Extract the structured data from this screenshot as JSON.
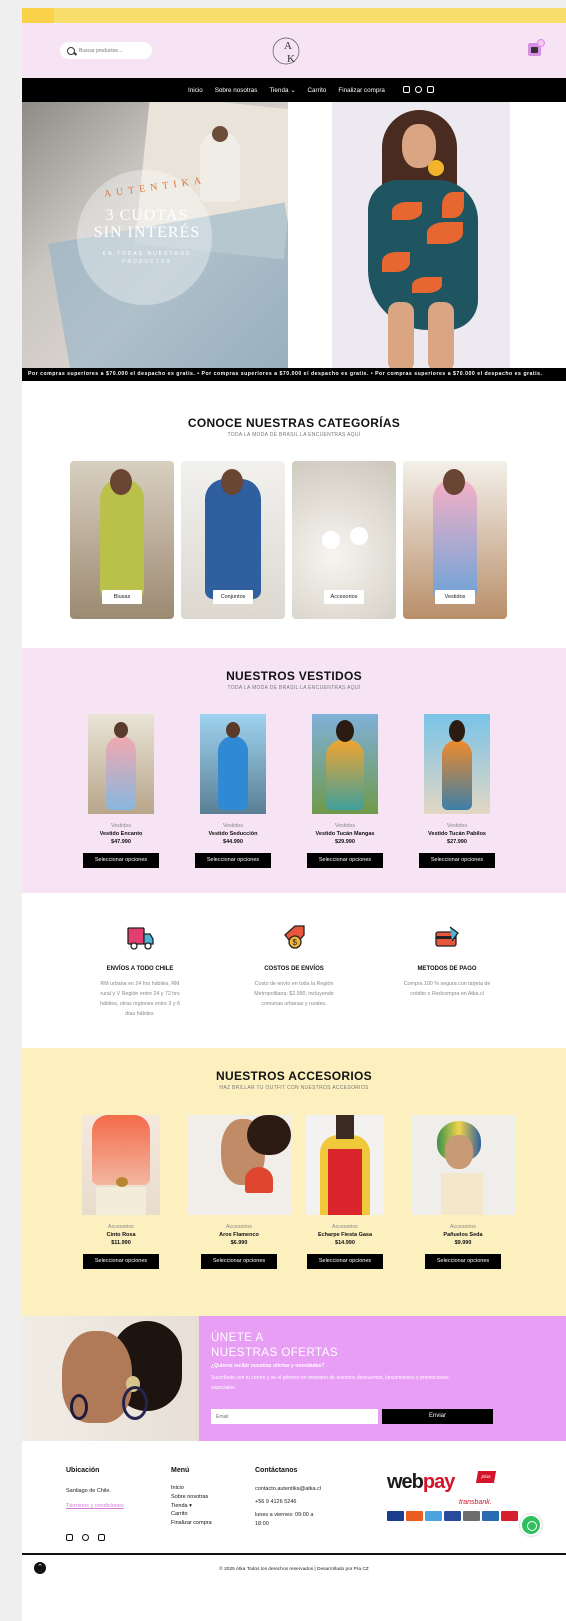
{
  "header": {
    "search_placeholder": "Buscar productos…",
    "logo_text": "AK"
  },
  "nav": {
    "items": [
      "Inicio",
      "Sobre nosotras",
      "Tienda ⌄",
      "Carrito",
      "Finalizar compra"
    ]
  },
  "hero": {
    "brand": "AUTENTIKA",
    "headline_1": "3 CUOTAS",
    "headline_2": "SIN INTERÉS",
    "small_1": "EN TODAS NUESTROS",
    "small_2": "PRODUCTOS"
  },
  "marquee": "Por compras superiores a $70.000 el despacho es gratis. • Por compras superiores a $70.000 el despacho es gratis. • Por compras superiores a $70.000 el despacho es gratis.",
  "categories": {
    "title": "CONOCE NUESTRAS CATEGORÍAS",
    "subtitle": "TODA LA MODA DE BRASIL LA ENCUENTRAS AQUÍ",
    "items": [
      "Blusas",
      "Conjuntos",
      "Accesorios",
      "Vestidos"
    ]
  },
  "dresses": {
    "title": "NUESTROS VESTIDOS",
    "subtitle": "TODA LA MODA DE BRASIL LA ENCUENTRAS AQUÍ",
    "button": "Seleccionar opciones",
    "items": [
      {
        "cat": "Vestidos",
        "name": "Vestido Encanto",
        "price": "$47.990"
      },
      {
        "cat": "Vestidos",
        "name": "Vestido Seducción",
        "price": "$44.990"
      },
      {
        "cat": "Vestidos",
        "name": "Vestido Tucán Mangas",
        "price": "$29.990"
      },
      {
        "cat": "Vestidos",
        "name": "Vestido Tucán Pabilos",
        "price": "$27.990"
      }
    ]
  },
  "features": [
    {
      "title": "ENVÍOS A TODO CHILE",
      "desc_1": "RM urbana en 24 hrs hábiles, RM",
      "desc_2": "rural y V Región entre 24 y 72 hrs",
      "desc_3": "hábiles, otras regiones entre 3 y 6",
      "desc_4": "días hábiles."
    },
    {
      "title": "COSTOS DE ENVÍOS",
      "desc_1": "Costo de envío en toda la Región",
      "desc_2": "Metropolitana: $2.990, incluyendo",
      "desc_3": "comunas urbanas y rurales.",
      "desc_4": ""
    },
    {
      "title": "METODOS DE PAGO",
      "desc_1": "Compra 100 % segura con tarjeta de",
      "desc_2": "crédito o Redcompra en Atka.cl",
      "desc_3": "",
      "desc_4": ""
    }
  ],
  "accessories": {
    "title": "NUESTROS ACCESORIOS",
    "subtitle": "HAZ BRILLAR TU OUTFIT CON NUESTROS ACCESORIOS",
    "button": "Seleccionar opciones",
    "items": [
      {
        "cat": "Accesorios",
        "name": "Cinto Rosa",
        "price": "$11.990"
      },
      {
        "cat": "Accesorios",
        "name": "Aros Flamenco",
        "price": "$6.990"
      },
      {
        "cat": "Accesorios",
        "name": "Echarpe Fiesta Gasa",
        "price": "$14.990"
      },
      {
        "cat": "Accesorios",
        "name": "Pañuelos Seda",
        "price": "$9.990"
      }
    ]
  },
  "newsletter": {
    "title_1": "ÚNETE A",
    "title_2": "NUESTRAS OFERTAS",
    "question": "¿Quieres recibir nuestras ofertas y novedades?",
    "text": "Suscríbete con tu correo y sé el primero en enterarte de nuestros descuentos, lanzamientos y promociones especiales.",
    "email_placeholder": "Email",
    "button": "Enviar"
  },
  "footer": {
    "location_title": "Ubicación",
    "location": "Santiago de Chile.",
    "terms": "Términos y condiciones",
    "menu_title": "Menú",
    "menu": [
      "Inicio",
      "Sobre nosotras",
      "Tienda ▾",
      "Carrito",
      "Finalizar compra"
    ],
    "contact_title": "Contáctanos",
    "email": "contacto.autentika@atka.cl",
    "phone": "+56 9 4126 5246",
    "hours_1": "lunes a viernes: 09:00 a",
    "hours_2": "18:00",
    "webpay_1": "web",
    "webpay_2": "pay",
    "webpay_plus": "plus",
    "transbank": "transbank.",
    "copyright": "© 2025 Atka Todos los derechos reservados | Desarrollado por Pía CZ"
  },
  "colors": {
    "header_bg": "#f6e4f5",
    "dresses_bg": "#f6e4f5",
    "accessories_bg": "#fdf0bf",
    "newsletter_bg": "#e89ef5",
    "accent_link": "#d57bd9"
  },
  "icons": [
    "search-icon",
    "cart-icon",
    "instagram-icon",
    "facebook-icon",
    "tiktok-icon",
    "truck-icon",
    "shipping-cost-icon",
    "credit-card-icon",
    "whatsapp-icon",
    "scroll-up-icon"
  ]
}
